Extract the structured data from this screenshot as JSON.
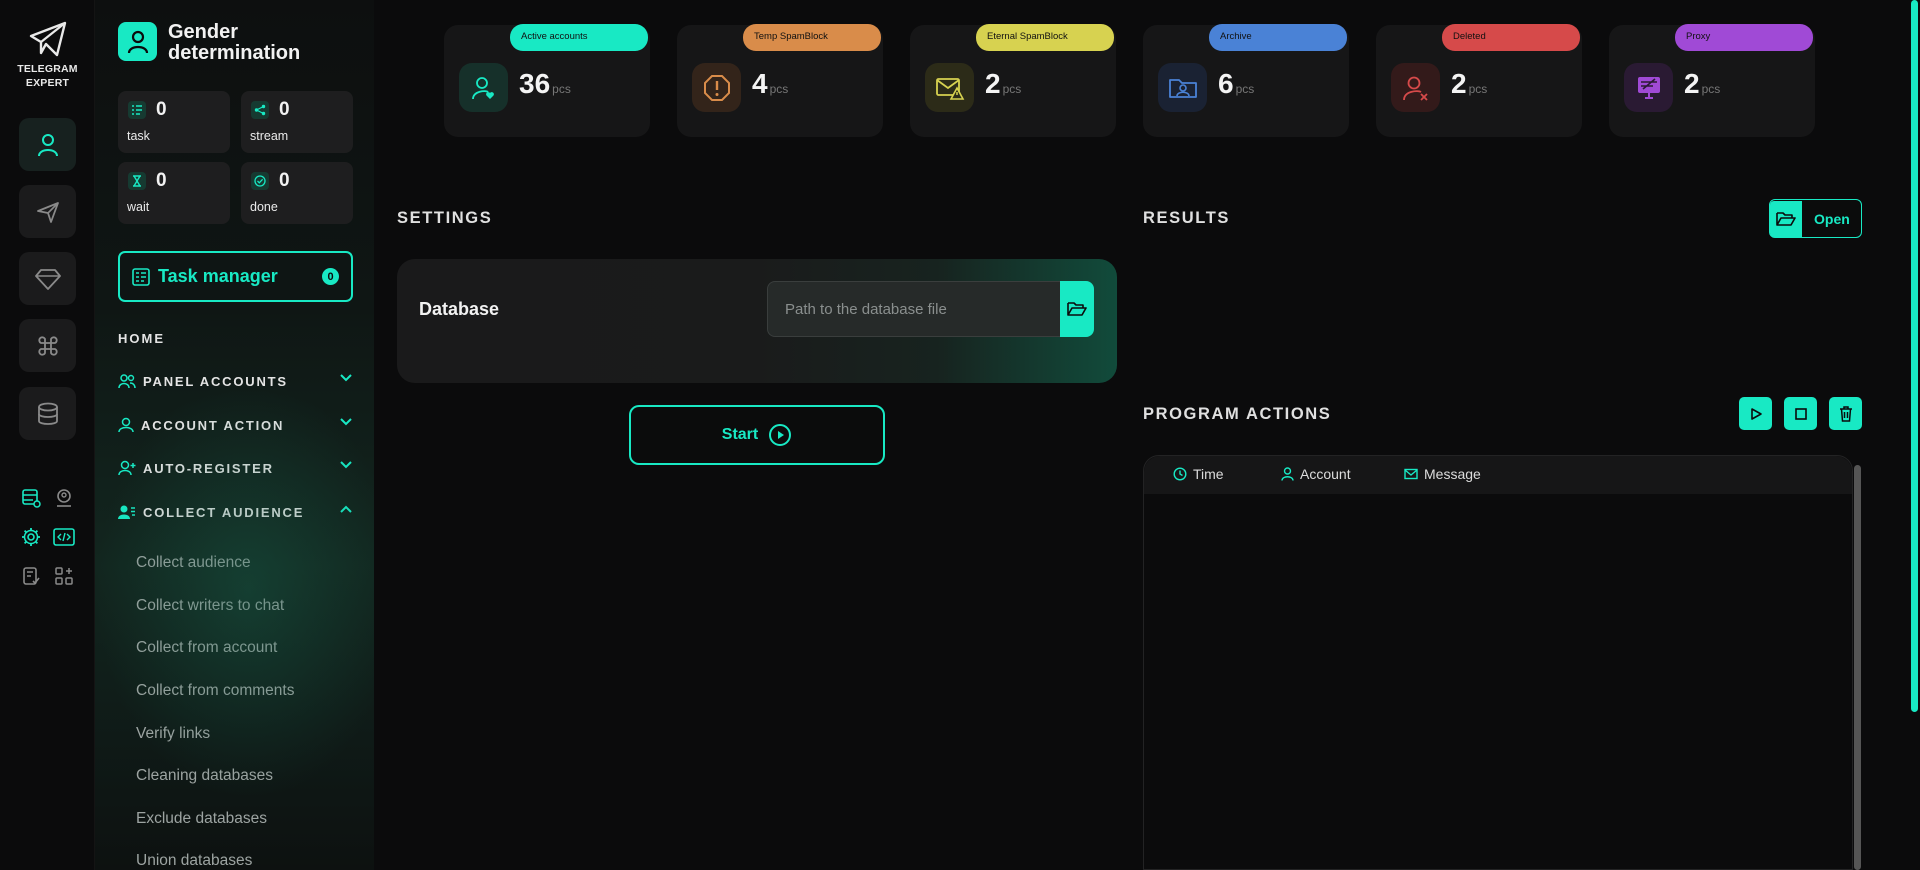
{
  "app": {
    "logo_line1": "TELEGRAM",
    "logo_line2": "EXPERT"
  },
  "sidebar": {
    "title": "Gender determination",
    "stats": [
      {
        "value": "0",
        "label": "task"
      },
      {
        "value": "0",
        "label": "stream"
      },
      {
        "value": "0",
        "label": "wait"
      },
      {
        "value": "0",
        "label": "done"
      }
    ],
    "task_manager": {
      "label": "Task manager",
      "count": "0"
    },
    "home": "HOME",
    "sections": [
      {
        "label": "PANEL ACCOUNTS",
        "expanded": false
      },
      {
        "label": "ACCOUNT ACTION",
        "expanded": false
      },
      {
        "label": "AUTO-REGISTER",
        "expanded": false
      },
      {
        "label": "COLLECT AUDIENCE",
        "expanded": true
      }
    ],
    "sub_items": [
      "Collect audience",
      "Collect writers to chat",
      "Collect from account",
      "Collect from comments",
      "Verify links",
      "Cleaning databases",
      "Exclude databases",
      "Union databases"
    ]
  },
  "cards": [
    {
      "label": "Active accounts",
      "value": "36",
      "unit": "pcs",
      "color": "#18e9c4"
    },
    {
      "label": "Temp SpamBlock",
      "value": "4",
      "unit": "pcs",
      "color": "#d98c4a"
    },
    {
      "label": "Eternal SpamBlock",
      "value": "2",
      "unit": "pcs",
      "color": "#d7d250"
    },
    {
      "label": "Archive",
      "value": "6",
      "unit": "pcs",
      "color": "#4a82d6"
    },
    {
      "label": "Deleted",
      "value": "2",
      "unit": "pcs",
      "color": "#d64a4a"
    },
    {
      "label": "Proxy",
      "value": "2",
      "unit": "pcs",
      "color": "#a04ad6"
    }
  ],
  "settings": {
    "title": "SETTINGS",
    "database_label": "Database",
    "database_placeholder": "Path to the database file",
    "start_label": "Start"
  },
  "results": {
    "title": "RESULTS",
    "open_label": "Open"
  },
  "program_actions": {
    "title": "PROGRAM ACTIONS",
    "columns": [
      "Time",
      "Account",
      "Message"
    ]
  },
  "colors": {
    "accent": "#18e9c4",
    "background": "#0b0b0c",
    "panel": "#161617"
  }
}
